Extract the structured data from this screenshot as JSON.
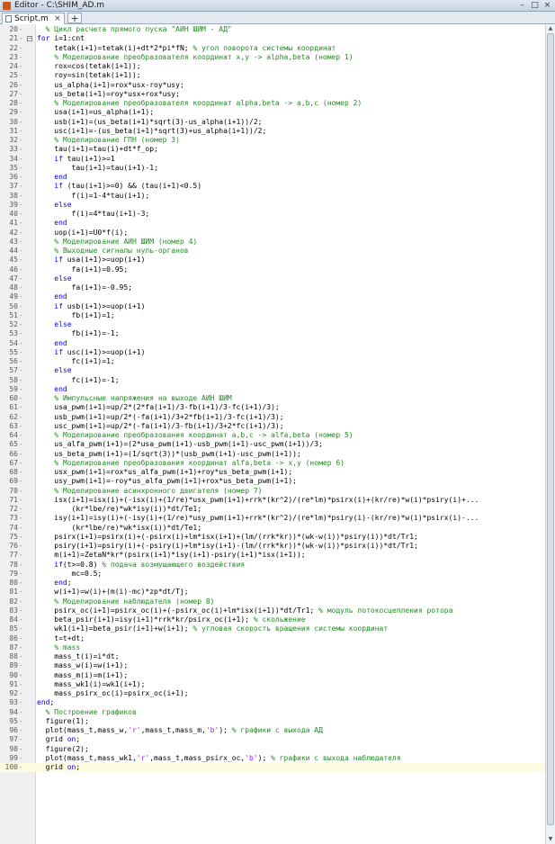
{
  "window": {
    "title": "Editor - C:\\SHIM_AD.m",
    "minimize": "–",
    "maximize": "□",
    "close": "×"
  },
  "tabs": [
    {
      "label": "Script.m",
      "close": "×"
    }
  ],
  "add_tab_label": "+",
  "current_line": 100,
  "lines": [
    {
      "n": 20,
      "text": "  % Цикл расчета прямого пуска \"АИН ШИМ - АД\""
    },
    {
      "n": 21,
      "text": "for i=1:cnt",
      "fold": true
    },
    {
      "n": 22,
      "text": "    tetak(i+1)=tetak(i)+dt*2*pi*fN; % угол поворота системы координат"
    },
    {
      "n": 23,
      "text": "    % Моделирование преобразователя координат x,y -> alpha,beta (номер 1)"
    },
    {
      "n": 24,
      "text": "    rox=cos(tetak(i+1));"
    },
    {
      "n": 25,
      "text": "    roy=sin(tetak(i+1));"
    },
    {
      "n": 26,
      "text": "    us_alpha(i+1)=rox*usx-roy*usy;"
    },
    {
      "n": 27,
      "text": "    us_beta(i+1)=roy*usx+rox*usy;"
    },
    {
      "n": 28,
      "text": "    % Моделирование преобразователя координат alpha,beta -> a,b,c (номер 2)"
    },
    {
      "n": 29,
      "text": "    usa(i+1)=us_alpha(i+1);"
    },
    {
      "n": 30,
      "text": "    usb(i+1)=(us_beta(i+1)*sqrt(3)-us_alpha(i+1))/2;"
    },
    {
      "n": 31,
      "text": "    usc(i+1)=-(us_beta(i+1)*sqrt(3)+us_alpha(i+1))/2;"
    },
    {
      "n": 32,
      "text": "    % Моделирование ГПН (номер 3)"
    },
    {
      "n": 33,
      "text": "    tau(i+1)=tau(i)+dt*f_op;"
    },
    {
      "n": 34,
      "text": "    if tau(i+1)>=1"
    },
    {
      "n": 35,
      "text": "        tau(i+1)=tau(i+1)-1;"
    },
    {
      "n": 36,
      "text": "    end"
    },
    {
      "n": 37,
      "text": "    if (tau(i+1)>=0) && (tau(i+1)<0.5)"
    },
    {
      "n": 38,
      "text": "        f(i)=1-4*tau(i+1);"
    },
    {
      "n": 39,
      "text": "    else"
    },
    {
      "n": 40,
      "text": "        f(i)=4*tau(i+1)-3;"
    },
    {
      "n": 41,
      "text": "    end"
    },
    {
      "n": 42,
      "text": "    uop(i+1)=U0*f(i);"
    },
    {
      "n": 43,
      "text": "    % Моделирование АИН ШИМ (номер 4)"
    },
    {
      "n": 44,
      "text": "    % Выходные сигналы нуль-органов"
    },
    {
      "n": 45,
      "text": "    if usa(i+1)>=uop(i+1)"
    },
    {
      "n": 46,
      "text": "        fa(i+1)=0.95;"
    },
    {
      "n": 47,
      "text": "    else"
    },
    {
      "n": 48,
      "text": "        fa(i+1)=-0.95;"
    },
    {
      "n": 49,
      "text": "    end"
    },
    {
      "n": 50,
      "text": "    if usb(i+1)>=uop(i+1)"
    },
    {
      "n": 51,
      "text": "        fb(i+1)=1;"
    },
    {
      "n": 52,
      "text": "    else"
    },
    {
      "n": 53,
      "text": "        fb(i+1)=-1;"
    },
    {
      "n": 54,
      "text": "    end"
    },
    {
      "n": 55,
      "text": "    if usc(i+1)>=uop(i+1)"
    },
    {
      "n": 56,
      "text": "        fc(i+1)=1;"
    },
    {
      "n": 57,
      "text": "    else"
    },
    {
      "n": 58,
      "text": "        fc(i+1)=-1;"
    },
    {
      "n": 59,
      "text": "    end"
    },
    {
      "n": 60,
      "text": "    % Импульсные напряжения на выходе АИН ШИМ"
    },
    {
      "n": 61,
      "text": "    usa_pwm(i+1)=up/2*(2*fa(i+1)/3-fb(i+1)/3-fc(i+1)/3);"
    },
    {
      "n": 62,
      "text": "    usb_pwm(i+1)=up/2*(-fa(i+1)/3+2*fb(i+1)/3-fc(i+1)/3);"
    },
    {
      "n": 63,
      "text": "    usc_pwm(i+1)=up/2*(-fa(i+1)/3-fb(i+1)/3+2*fc(i+1)/3);"
    },
    {
      "n": 64,
      "text": "    % Моделирование преобразования координат a,b,c -> alfa,beta (номер 5)"
    },
    {
      "n": 65,
      "text": "    us_alfa_pwm(i+1)=(2*usa_pwm(i+1)-usb_pwm(i+1)-usc_pwm(i+1))/3;"
    },
    {
      "n": 66,
      "text": "    us_beta_pwm(i+1)=(1/sqrt(3))*(usb_pwm(i+1)-usc_pwm(i+1));"
    },
    {
      "n": 67,
      "text": "    % Моделирование преобразования координат alfa,beta -> x,y (номер 6)"
    },
    {
      "n": 68,
      "text": "    usx_pwm(i+1)=rox*us_alfa_pwm(i+1)+roy*us_beta_pwm(i+1);"
    },
    {
      "n": 69,
      "text": "    usy_pwm(i+1)=-roy*us_alfa_pwm(i+1)+rox*us_beta_pwm(i+1);"
    },
    {
      "n": 70,
      "text": "    % Моделирование асинхронного двигателя (номер 7)"
    },
    {
      "n": 71,
      "text": "    isx(i+1)=isx(i)+(-isx(i)+(1/re)*usx_pwm(i+1)+rrk*(kr^2)/(re*lm)*psirx(i)+(kr/re)*w(i)*psiry(i)+..."
    },
    {
      "n": 72,
      "text": "        (kr*lbe/re)*wk*isy(i))*dt/Te1;"
    },
    {
      "n": 73,
      "text": "    isy(i+1)=isy(i)+(-isy(i)+(1/re)*usy_pwm(i+1)+rrk*(kr^2)/(re*lm)*psiry(i)-(kr/re)*w(i)*psirx(i)-..."
    },
    {
      "n": 74,
      "text": "        (kr*lbe/re)*wk*isx(i))*dt/Te1;"
    },
    {
      "n": 75,
      "text": "    psirx(i+1)=psirx(i)+(-psirx(i)+lm*isx(i+1)+(lm/(rrk*kr))*(wk-w(i))*psiry(i))*dt/Tr1;"
    },
    {
      "n": 76,
      "text": "    psiry(i+1)=psiry(i)+(-psiry(i)+lm*isy(i+1)-(lm/(rrk*kr))*(wk-w(i))*psirx(i))*dt/Tr1;"
    },
    {
      "n": 77,
      "text": "    m(i+1)=ZetaN*kr*(psirx(i+1)*isy(i+1)-psiry(i+1)*isx(i+1));"
    },
    {
      "n": 78,
      "text": "    if(t>=0.8) % подача возмущающего воздействия"
    },
    {
      "n": 79,
      "text": "        mc=0.5;"
    },
    {
      "n": 80,
      "text": "    end;"
    },
    {
      "n": 81,
      "text": "    w(i+1)=w(i)+(m(i)-mc)*zp*dt/Tj;"
    },
    {
      "n": 82,
      "text": "    % Моделирование наблюдателя (номер 8)"
    },
    {
      "n": 83,
      "text": "    psirx_oc(i+1)=psirx_oc(i)+(-psirx_oc(i)+lm*isx(i+1))*dt/Tr1; % модуль потокосцепления ротора"
    },
    {
      "n": 84,
      "text": "    beta_psir(i+1)=isy(i+1)*rrk*kr/psirx_oc(i+1); % скольжение"
    },
    {
      "n": 85,
      "text": "    wk1(i+1)=beta_psir(i+1)+w(i+1); % угловая скорость вращения системы координат"
    },
    {
      "n": 86,
      "text": "    t=t+dt;"
    },
    {
      "n": 87,
      "text": "    % mass"
    },
    {
      "n": 88,
      "text": "    mass_t(i)=i*dt;"
    },
    {
      "n": 89,
      "text": "    mass_w(i)=w(i+1);"
    },
    {
      "n": 90,
      "text": "    mass_m(i)=m(i+1);"
    },
    {
      "n": 91,
      "text": "    mass_wk1(i)=wk1(i+1);"
    },
    {
      "n": 92,
      "text": "    mass_psirx_oc(i)=psirx_oc(i+1);"
    },
    {
      "n": 93,
      "text": "end;",
      "fold_end": true
    },
    {
      "n": 94,
      "text": "  % Построение графиков"
    },
    {
      "n": 95,
      "text": "  figure(1);"
    },
    {
      "n": 96,
      "text": "  plot(mass_t,mass_w,'r',mass_t,mass_m,'b'); % графики с выхода АД"
    },
    {
      "n": 97,
      "text": "  grid on;"
    },
    {
      "n": 98,
      "text": "  figure(2);"
    },
    {
      "n": 99,
      "text": "  plot(mass_t,mass_wk1,'r',mass_t,mass_psirx_oc,'b'); % графики с выхода наблюдателя"
    },
    {
      "n": 100,
      "text": "  grid on;"
    }
  ]
}
